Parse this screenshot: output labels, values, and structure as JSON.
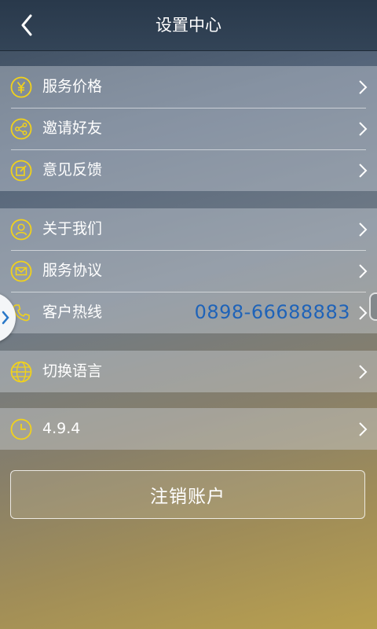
{
  "header": {
    "title": "设置中心",
    "back_icon": "back-arrow-icon"
  },
  "groups": [
    {
      "items": [
        {
          "label": "服务价格",
          "icon": "yen-circle-icon"
        },
        {
          "label": "邀请好友",
          "icon": "share-circle-icon"
        },
        {
          "label": "意见反馈",
          "icon": "feedback-edit-icon"
        }
      ]
    },
    {
      "items": [
        {
          "label": "关于我们",
          "icon": "user-circle-icon"
        },
        {
          "label": "服务协议",
          "icon": "envelope-circle-icon"
        },
        {
          "label": "客户热线",
          "icon": "phone-icon",
          "value": "0898-66688883"
        }
      ]
    },
    {
      "items": [
        {
          "label": "切换语言",
          "icon": "globe-icon"
        }
      ]
    },
    {
      "items": [
        {
          "label": "4.9.4",
          "icon": "clock-icon"
        }
      ]
    }
  ],
  "logout_button": {
    "label": "注销账户"
  },
  "colors": {
    "icon_yellow": "#f2d21a",
    "hotline_blue": "#1f63b8",
    "header_bg": "#2d3d50"
  }
}
